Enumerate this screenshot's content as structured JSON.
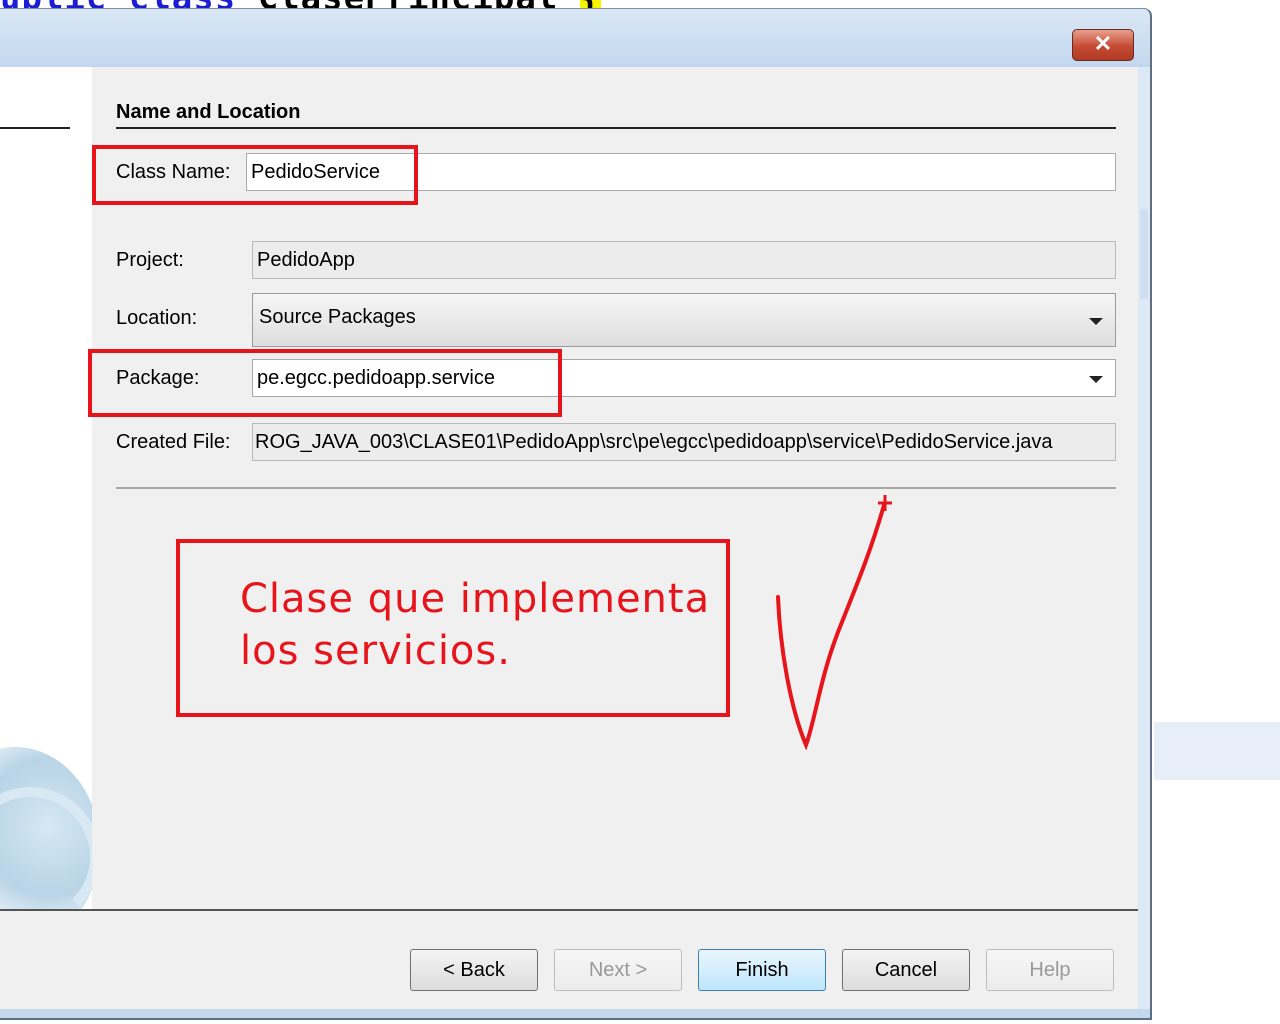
{
  "background_editor": {
    "keyword_public": "ublic",
    "keyword_class": "class",
    "class_name": "ClasePrincipal",
    "brace": "{"
  },
  "dialog": {
    "close_label": "✕",
    "section_title": "Name and Location",
    "fields": {
      "class_name": {
        "label": "Class Name:",
        "value": "PedidoService"
      },
      "project": {
        "label": "Project:",
        "value": "PedidoApp"
      },
      "location": {
        "label": "Location:",
        "value": "Source Packages"
      },
      "package": {
        "label": "Package:",
        "value": "pe.egcc.pedidoapp.service"
      },
      "created_file": {
        "label": "Created File:",
        "value": "ROG_JAVA_003\\CLASE01\\PedidoApp\\src\\pe\\egcc\\pedidoapp\\service\\PedidoService.java"
      }
    },
    "annotation": {
      "line1": "Clase que implementa",
      "line2": "los servicios.",
      "color": "#e8141b"
    },
    "buttons": {
      "back": "< Back",
      "next": "Next >",
      "finish": "Finish",
      "cancel": "Cancel",
      "help": "Help"
    }
  }
}
